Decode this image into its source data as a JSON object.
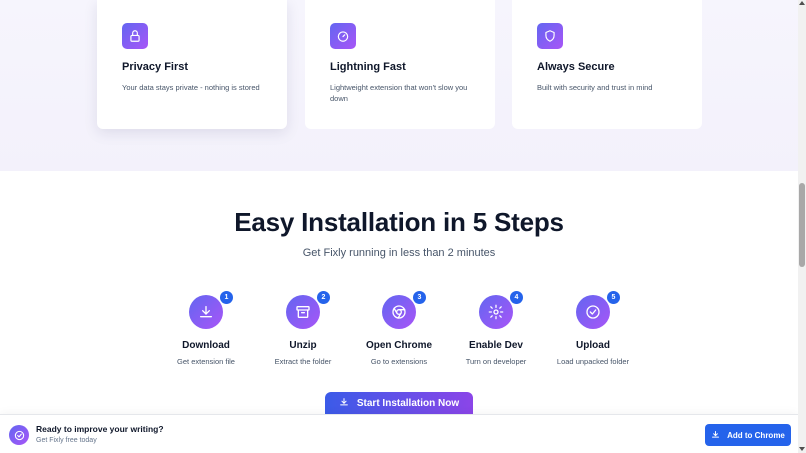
{
  "features": [
    {
      "icon": "lock-icon",
      "title": "Privacy First",
      "description": "Your data stays private - nothing is stored"
    },
    {
      "icon": "speedometer-icon",
      "title": "Lightning Fast",
      "description": "Lightweight extension that won't slow you down"
    },
    {
      "icon": "shield-icon",
      "title": "Always Secure",
      "description": "Built with security and trust in mind"
    }
  ],
  "installation": {
    "title": "Easy Installation in 5 Steps",
    "subtitle": "Get Fixly running in less than 2 minutes",
    "steps": [
      {
        "number": "1",
        "icon": "download-icon",
        "name": "Download",
        "description": "Get extension file"
      },
      {
        "number": "2",
        "icon": "archive-icon",
        "name": "Unzip",
        "description": "Extract the folder"
      },
      {
        "number": "3",
        "icon": "chrome-icon",
        "name": "Open Chrome",
        "description": "Go to extensions"
      },
      {
        "number": "4",
        "icon": "gear-icon",
        "name": "Enable Dev",
        "description": "Turn on developer"
      },
      {
        "number": "5",
        "icon": "check-circle-icon",
        "name": "Upload",
        "description": "Load unpacked folder"
      }
    ],
    "cta_label": "Start Installation Now"
  },
  "bottom_bar": {
    "title": "Ready to improve your writing?",
    "subtitle": "Get Fixly free today",
    "button_label": "Add to Chrome"
  },
  "colors": {
    "accent_blue": "#2563eb",
    "gradient_start": "#6366f1",
    "gradient_end": "#a855f7",
    "band_background": "#f6f5fd"
  }
}
